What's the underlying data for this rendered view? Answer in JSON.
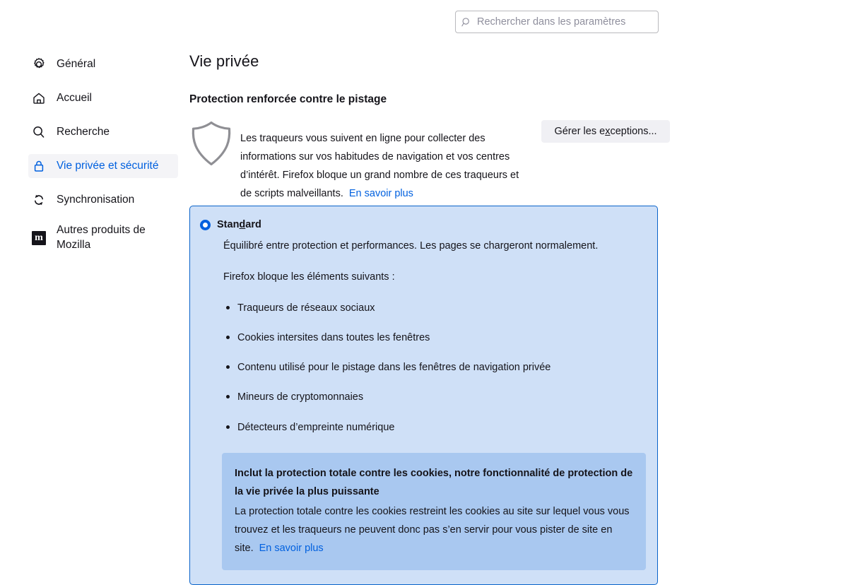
{
  "search": {
    "placeholder": "Rechercher dans les paramètres",
    "icon": "search-icon"
  },
  "sidebar": {
    "items": [
      {
        "label": "Général",
        "icon": "gear-icon",
        "active": false
      },
      {
        "label": "Accueil",
        "icon": "home-icon",
        "active": false
      },
      {
        "label": "Recherche",
        "icon": "search-icon",
        "active": false
      },
      {
        "label": "Vie privée et sécurité",
        "icon": "lock-icon",
        "active": true
      },
      {
        "label": "Synchronisation",
        "icon": "sync-icon",
        "active": false
      },
      {
        "label": "Autres produits de Mozilla",
        "icon": "mozilla-icon",
        "active": false
      }
    ]
  },
  "main": {
    "page_title": "Vie privée",
    "section_title": "Protection renforcée contre le pistage",
    "intro": {
      "icon": "shield-icon",
      "text": "Les traqueurs vous suivent en ligne pour collecter des informations sur vos habitudes de navigation et vos centres d’intérêt. Firefox bloque un grand nombre de ces traqueurs et de scripts malveillants.",
      "link_label": "En savoir plus"
    },
    "exceptions_button": {
      "prefix": "Gérer les e",
      "accesskey": "x",
      "suffix": "ceptions..."
    },
    "standard_panel": {
      "radio_selected": true,
      "label_prefix": "Stan",
      "label_accesskey": "d",
      "label_suffix": "ard",
      "description": "Équilibré entre protection et performances. Les pages se chargeront normalement.",
      "blocks_intro": "Firefox bloque les éléments suivants :",
      "blocked_items": [
        "Traqueurs de réseaux sociaux",
        "Cookies intersites dans toutes les fenêtres",
        "Contenu utilisé pour le pistage dans les fenêtres de navigation privée",
        "Mineurs de cryptomonnaies",
        "Détecteurs d’empreinte numérique"
      ],
      "info_box": {
        "title": "Inclut la protection totale contre les cookies, notre fonctionnalité de protection de la vie privée la plus puissante",
        "text": "La protection totale contre les cookies restreint les cookies au site sur lequel vous vous trouvez et les traqueurs ne peuvent donc pas s’en servir pour vous pister de site en site.",
        "link_label": "En savoir plus"
      }
    }
  },
  "colors": {
    "accent_blue": "#0060df",
    "panel_bg": "#cfe0f7",
    "panel_border": "#0a63c9",
    "info_bg": "#a9c8f0",
    "button_bg": "#f0f0f4",
    "text": "#15141a",
    "muted": "#8f8f9d"
  }
}
